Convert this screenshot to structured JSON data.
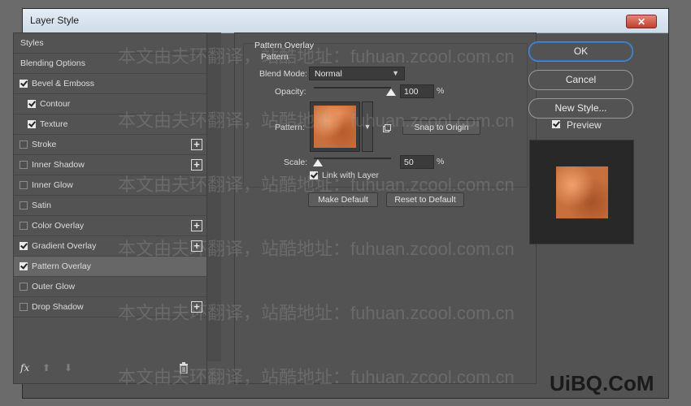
{
  "window": {
    "title": "Layer Style",
    "close_label": "✕"
  },
  "styles_list": [
    {
      "label": "Styles",
      "checkbox": false,
      "checked": false,
      "plus": false,
      "indent": false,
      "active": false
    },
    {
      "label": "Blending Options",
      "checkbox": false,
      "checked": false,
      "plus": false,
      "indent": false,
      "active": false
    },
    {
      "label": "Bevel & Emboss",
      "checkbox": true,
      "checked": true,
      "plus": false,
      "indent": false,
      "active": false
    },
    {
      "label": "Contour",
      "checkbox": true,
      "checked": true,
      "plus": false,
      "indent": true,
      "active": false
    },
    {
      "label": "Texture",
      "checkbox": true,
      "checked": true,
      "plus": false,
      "indent": true,
      "active": false
    },
    {
      "label": "Stroke",
      "checkbox": true,
      "checked": false,
      "plus": true,
      "indent": false,
      "active": false
    },
    {
      "label": "Inner Shadow",
      "checkbox": true,
      "checked": false,
      "plus": true,
      "indent": false,
      "active": false
    },
    {
      "label": "Inner Glow",
      "checkbox": true,
      "checked": false,
      "plus": false,
      "indent": false,
      "active": false
    },
    {
      "label": "Satin",
      "checkbox": true,
      "checked": false,
      "plus": false,
      "indent": false,
      "active": false
    },
    {
      "label": "Color Overlay",
      "checkbox": true,
      "checked": false,
      "plus": true,
      "indent": false,
      "active": false
    },
    {
      "label": "Gradient Overlay",
      "checkbox": true,
      "checked": true,
      "plus": true,
      "indent": false,
      "active": false
    },
    {
      "label": "Pattern Overlay",
      "checkbox": true,
      "checked": true,
      "plus": false,
      "indent": false,
      "active": true
    },
    {
      "label": "Outer Glow",
      "checkbox": true,
      "checked": false,
      "plus": false,
      "indent": false,
      "active": false
    },
    {
      "label": "Drop Shadow",
      "checkbox": true,
      "checked": false,
      "plus": true,
      "indent": false,
      "active": false
    }
  ],
  "bottom_bar": {
    "fx_label": "fx"
  },
  "pattern_overlay": {
    "section_title": "Pattern Overlay",
    "section_subtitle": "Pattern",
    "blend_mode_label": "Blend Mode:",
    "blend_mode_value": "Normal",
    "opacity_label": "Opacity:",
    "opacity_value": "100",
    "opacity_level": 100,
    "pattern_label": "Pattern:",
    "snap_button": "Snap to Origin",
    "scale_label": "Scale:",
    "scale_value": "50",
    "scale_level": 5,
    "percent": "%",
    "link_label": "Link with Layer",
    "link_checked": true,
    "make_default": "Make Default",
    "reset_default": "Reset to Default"
  },
  "right_panel": {
    "ok": "OK",
    "cancel": "Cancel",
    "new_style": "New Style...",
    "preview_label": "Preview",
    "preview_checked": true
  },
  "watermarks": [
    "本文由夫环翻译，站酷地址：fuhuan.zcool.com.cn"
  ],
  "logo_text": "UiBQ.CoM",
  "colors": {
    "accent": "#4a90e2",
    "dialog_bg": "#535353",
    "pattern": "#c8703d"
  }
}
